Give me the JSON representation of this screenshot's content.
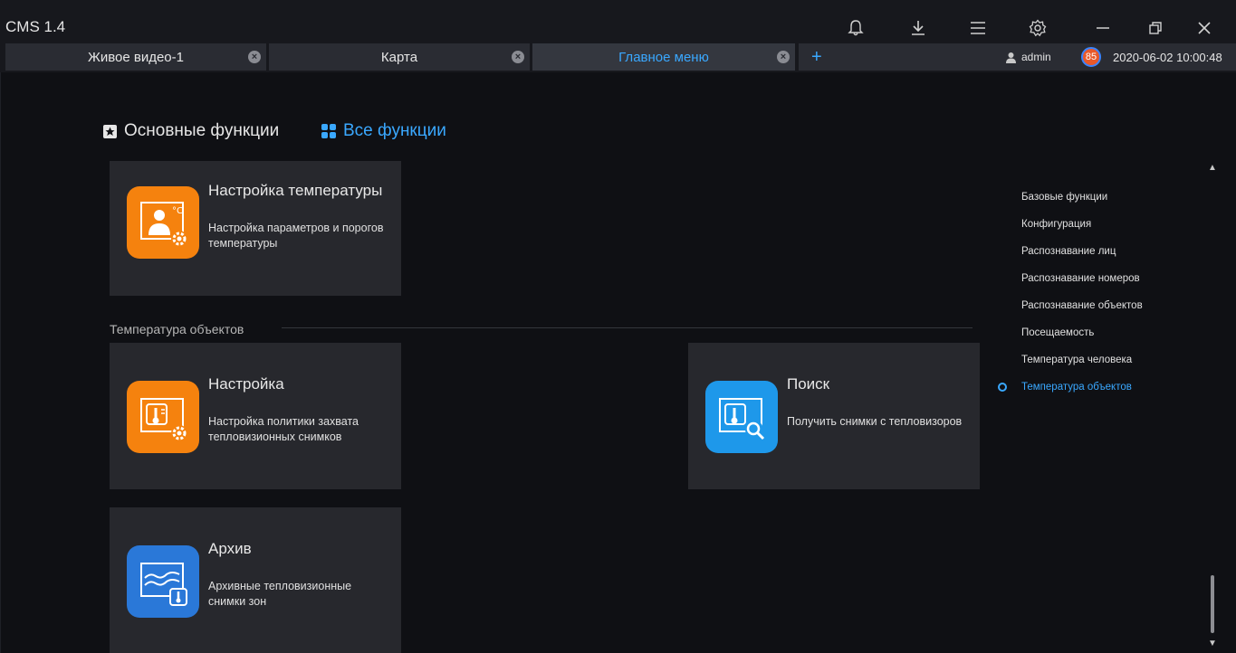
{
  "window": {
    "title": "CMS 1.4"
  },
  "tabs": [
    {
      "label": "Живое видео-1"
    },
    {
      "label": "Карта"
    },
    {
      "label": "Главное меню"
    }
  ],
  "status": {
    "user": "admin",
    "badge": "85",
    "datetime": "2020-06-02 10:00:48"
  },
  "menu_tabs": {
    "favorites": "Основные функции",
    "all": "Все функции"
  },
  "cards": {
    "temp_settings": {
      "title": "Настройка температуры",
      "desc": "Настройка параметров и порогов температуры"
    },
    "object_settings": {
      "title": "Настройка",
      "desc": "Настройка политики захвата тепловизионных снимков"
    },
    "search": {
      "title": "Поиск",
      "desc": "Получить снимки с тепловизоров"
    },
    "archive": {
      "title": "Архив",
      "desc": "Архивные тепловизионные снимки зон"
    }
  },
  "section": {
    "label": "Температура объектов"
  },
  "nav": [
    "Базовые функции",
    "Конфигурация",
    "Распознавание лиц",
    "Распознавание номеров",
    "Распознавание объектов",
    "Посещаемость",
    "Температура человека",
    "Температура объектов"
  ],
  "colors": {
    "accent": "#3aa8ff",
    "orange": "#f5820e",
    "blue": "#1e98ea"
  }
}
